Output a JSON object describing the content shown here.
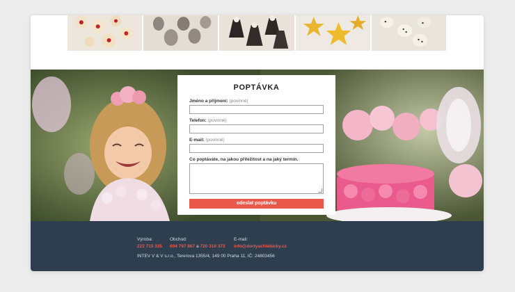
{
  "gallery": {
    "tiles": [
      {
        "name": "cookies-red-jam"
      },
      {
        "name": "cookies-coconut"
      },
      {
        "name": "gingerbread-angels"
      },
      {
        "name": "star-cookies"
      },
      {
        "name": "heart-cookies"
      }
    ]
  },
  "form": {
    "title": "POPTÁVKA",
    "name_label": "Jméno a příjmení:",
    "name_optional": "(povinné)",
    "phone_label": "Telefon:",
    "phone_optional": "(povinné)",
    "email_label": "E-mail:",
    "email_optional": "(povinné)",
    "message_label": "Co poptáváte, na jakou příležitost a na jaký termín.",
    "submit_label": "odeslat poptávku"
  },
  "footer": {
    "production_label": "Výroba:",
    "production_phone": "222 715 335",
    "shop_label": "Obchod:",
    "shop_phone_1": "604 797 867",
    "shop_and": " a ",
    "shop_phone_2": "720 310 373",
    "email_label": "E-mail:",
    "email_value": "info@dortyachlebicky.cz",
    "address": "INTEV V & V s.r.o., Tererova 1355/4, 149 00 Praha 11, IČ: 24803456"
  },
  "colors": {
    "accent": "#e9594a",
    "footer_bg": "#2f3e4f",
    "page_bg": "#ececec"
  }
}
